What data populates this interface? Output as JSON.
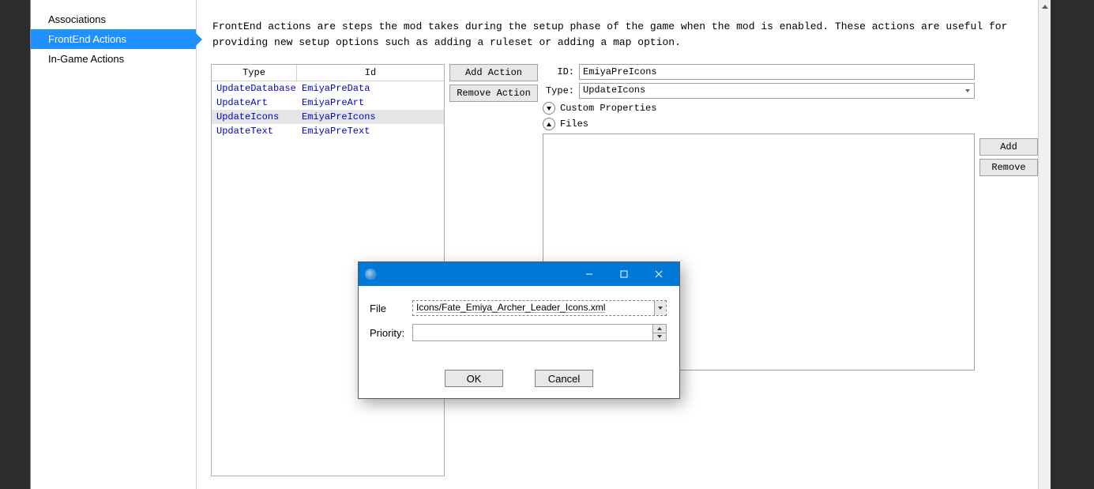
{
  "nav": {
    "items": [
      {
        "label": "Associations",
        "active": false
      },
      {
        "label": "FrontEnd Actions",
        "active": true
      },
      {
        "label": "In-Game Actions",
        "active": false
      }
    ]
  },
  "description": "FrontEnd actions are steps the mod takes during the setup phase of the game when the mod is enabled.   These actions are useful for providing new setup options such as adding a ruleset or adding a map option.",
  "table": {
    "headers": {
      "type": "Type",
      "id": "Id"
    },
    "rows": [
      {
        "type": "UpdateDatabase",
        "id": "EmiyaPreData",
        "selected": false
      },
      {
        "type": "UpdateArt",
        "id": "EmiyaPreArt",
        "selected": false
      },
      {
        "type": "UpdateIcons",
        "id": "EmiyaPreIcons",
        "selected": true
      },
      {
        "type": "UpdateText",
        "id": "EmiyaPreText",
        "selected": false
      }
    ]
  },
  "midButtons": {
    "add": "Add Action",
    "remove": "Remove Action"
  },
  "form": {
    "idLabel": "ID:",
    "idValue": "EmiyaPreIcons",
    "typeLabel": "Type:",
    "typeValue": "UpdateIcons",
    "customProps": "Custom Properties",
    "files": "Files"
  },
  "sideButtons": {
    "add": "Add",
    "remove": "Remove"
  },
  "dialog": {
    "fileLabel": "File",
    "fileValue": "Icons/Fate_Emiya_Archer_Leader_Icons.xml",
    "priorityLabel": "Priority:",
    "priorityValue": "",
    "ok": "OK",
    "cancel": "Cancel"
  }
}
